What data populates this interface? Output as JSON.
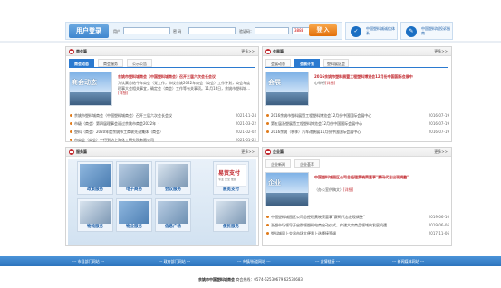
{
  "login": {
    "title": "用户登录",
    "user_label": "用户",
    "password_label": "密  码",
    "captcha_label": "验证码：",
    "captcha_value": "3888",
    "submit": "登 入"
  },
  "side_buttons": [
    {
      "icon": "shield-icon",
      "label": "中国塑料城诚信体系"
    },
    {
      "icon": "document-icon",
      "label": "中国塑料城投诉指南"
    }
  ],
  "colors": {
    "accent": "#2b7ad0",
    "headline": "#c1272d",
    "footer": "#3c86cf",
    "login_btn": "#e2700b"
  },
  "panels": {
    "more_label": "更多>>",
    "chamber": {
      "title": "商会篇",
      "tabs": [
        "商会动态",
        "商会服务",
        "公示公告"
      ],
      "thumb_caption": "商会动态",
      "headline": "余姚市塑料城商会（中国塑料城商会）召开三届六次会长会议",
      "summary": "为认真总结今年商会（党工作，审议余姚2022年商会（商会）工作计划，商会年度理事大会相关事宜，确定会（商会）工作等有关事项。11月16日，余姚市塑料城... ",
      "detail": "[详细]",
      "items": [
        {
          "text": "余姚市塑料城商会（中国塑料城商会）召开三届六次会长会议",
          "date": "2021-11-24"
        },
        {
          "text": "市级（商会）第四届理事会通过余姚市商会2022年（",
          "date": "2021-03-22"
        },
        {
          "text": "塑料（商会）2020年度余姚市工商联先进集体（商会）",
          "date": "2021-02-02"
        },
        {
          "text": "市商会（商会）一行到访上海化工研究院有限公司",
          "date": "2021-01-22"
        }
      ]
    },
    "exhibition": {
      "title": "会展篇",
      "tabs": [
        "会展动态",
        "会展计划",
        "塑料展区会"
      ],
      "thumb_caption": "会展",
      "headline": "2016余姚市塑料展暨工程塑料博览会12月份中国国际会展中",
      "summary": "心举行",
      "detail": "[详细]",
      "items": [
        {
          "text": "2016余姚市塑料展暨工程塑料博览会12月份中国国际会展中心",
          "date": "2016-07-19"
        },
        {
          "text": "第五届浙塑展暨工程塑料博览会12月份中国国际会展中心",
          "date": "2016-07-19"
        },
        {
          "text": "2016余姚（秋季）汽车改装展11月份中国国际会展中心",
          "date": "2016-07-19"
        }
      ]
    },
    "service": {
      "title": "服务篇",
      "tiles": [
        "政策服务",
        "电子商务",
        "会议服务",
        "展览支付",
        "物流服务",
        "物业服务",
        "信息广场",
        "便民服务"
      ],
      "ebuy_logo": "易贸支付",
      "ebuy_sub": "专业 安全 便捷"
    },
    "enterprise": {
      "title": "企业篇",
      "tabs": [
        "企业新闻",
        "企业荟萃"
      ],
      "thumb_caption": "企业",
      "headline": "中国塑料城园区公司总经理黄晓荣董事\"赛码代志出现调整\"",
      "summary": "（办公室供稿文）",
      "detail": "[详细]",
      "items": [
        {
          "text": "中国塑料城园区公司总经理黄晓荣董事\"赛码代志出现调整\"",
          "date": "2019-06-10"
        },
        {
          "text": "浙塑市场领导开启群领塑料电商启动仪式，传递大宗商品领域的发展机遇",
          "date": "2019-06-06"
        },
        {
          "text": "塑料城同上交易市场大便利上选择接签调",
          "date": "2017-11-06"
        }
      ]
    }
  },
  "footer": {
    "nav": [
      "--- 市县部门网站 ---",
      "--- 政府部门网站 ---",
      "--- 乡镇/街道网站 ---",
      "--- 友情链接 ---",
      "--- 新闻媒体网站 ---"
    ],
    "copyright_org": "余姚市中国塑料城商会",
    "copyright_rest": " 商会热线：0574-62530679 62530683"
  }
}
